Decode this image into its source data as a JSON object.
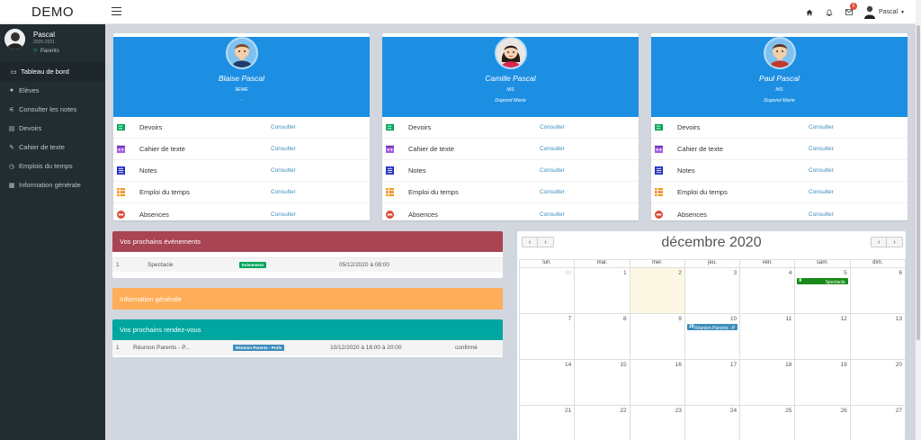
{
  "app": {
    "logo": "DEMO"
  },
  "topbar": {
    "notif_count": "6",
    "user": "Pascal"
  },
  "sidebar": {
    "user_name": "Pascal",
    "user_year": "2020-2021",
    "user_role": "Parents",
    "items": [
      {
        "label": "Tableau de bord",
        "icon": "laptop-icon"
      },
      {
        "label": "Elèves",
        "icon": "user-icon"
      },
      {
        "label": "Consulter les notes",
        "icon": "sliders-icon"
      },
      {
        "label": "Devoirs",
        "icon": "briefcase-icon"
      },
      {
        "label": "Cahier de texte",
        "icon": "edit-icon"
      },
      {
        "label": "Emplois du temps",
        "icon": "clock-icon"
      },
      {
        "label": "Information générale",
        "icon": "calendar-icon"
      }
    ]
  },
  "children": [
    {
      "name": "Blaise Pascal",
      "class": "3EME",
      "teacher": "-"
    },
    {
      "name": "Camille Pascal",
      "class": "MS",
      "teacher": "Dupond Marie"
    },
    {
      "name": "Paul Pascal",
      "class": "MS",
      "teacher": "Dupond Marie"
    }
  ],
  "card_rows": [
    {
      "label": "Devoirs",
      "color": "#00a65a"
    },
    {
      "label": "Cahier de texte",
      "color": "#a45ee5"
    },
    {
      "label": "Notes",
      "color": "#1f2fbf"
    },
    {
      "label": "Emploi du temps",
      "color": "#f39c12"
    },
    {
      "label": "Absences",
      "color": "#dd4b39"
    }
  ],
  "card_link": "Consulter",
  "events": {
    "title": "Vos prochains événements",
    "rows": [
      {
        "num": "1",
        "name": "Spectacle",
        "tag": "Evènement",
        "date": "05/12/2020 à 08:00"
      }
    ]
  },
  "info": {
    "title": "Information générale"
  },
  "rdv": {
    "title": "Vos prochains rendez-vous",
    "rows": [
      {
        "num": "1",
        "name": "Réunion Parents - P...",
        "tag": "Réunion Parents - Profs",
        "date": "10/12/2020 à 18:00 à 20:00",
        "status": "confirmé"
      }
    ]
  },
  "calendar": {
    "title": "décembre 2020",
    "prev": "‹",
    "next": "›",
    "days": [
      "lun.",
      "mar.",
      "mer.",
      "jeu.",
      "ven.",
      "sam.",
      "dim."
    ],
    "weeks": [
      [
        "30",
        "1",
        "2",
        "3",
        "4",
        "5",
        "6"
      ],
      [
        "7",
        "8",
        "9",
        "10",
        "11",
        "12",
        "13"
      ],
      [
        "14",
        "15",
        "16",
        "17",
        "18",
        "19",
        "20"
      ],
      [
        "21",
        "22",
        "23",
        "24",
        "25",
        "26",
        "27"
      ]
    ],
    "events": [
      {
        "time": "8",
        "label": "Spectacle"
      },
      {
        "time": "18",
        "label": "Réunion Parents - P"
      }
    ]
  },
  "colors": {
    "primary": "#1c8fe3",
    "events": "#a94453",
    "info": "#ffad58",
    "rdv": "#00a7a1",
    "sidebar": "#222d32"
  }
}
